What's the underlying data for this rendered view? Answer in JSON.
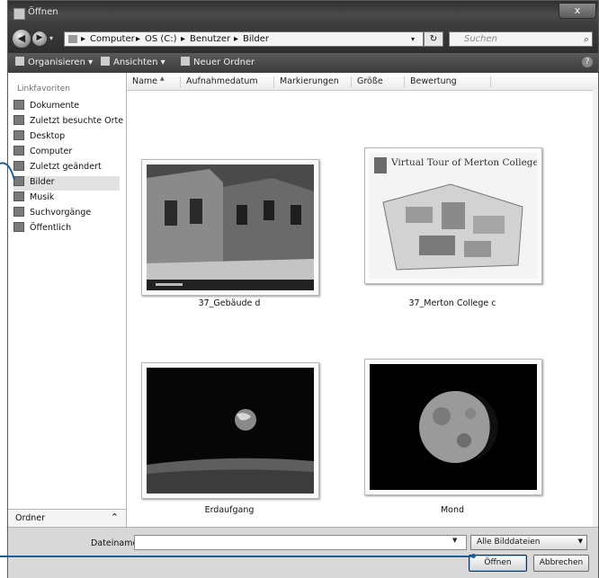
{
  "window": {
    "title": "Öffnen",
    "close_label": "x"
  },
  "address": {
    "crumbs": [
      "Computer",
      "OS (C:)",
      "Benutzer",
      "Bilder"
    ],
    "separator": "▸",
    "search_placeholder": "Suchen",
    "refresh_label": "↻",
    "dropdown_label": "▾"
  },
  "toolbar": {
    "organize": "Organisieren",
    "views": "Ansichten",
    "new_folder": "Neuer Ordner",
    "help": "?"
  },
  "nav": {
    "header": "Linkfavoriten",
    "items": [
      {
        "label": "Dokumente",
        "icon": "documents-icon"
      },
      {
        "label": "Zuletzt besuchte Orte",
        "icon": "recent-places-icon"
      },
      {
        "label": "Desktop",
        "icon": "desktop-icon"
      },
      {
        "label": "Computer",
        "icon": "computer-icon"
      },
      {
        "label": "Zuletzt geändert",
        "icon": "recently-changed-icon"
      },
      {
        "label": "Bilder",
        "icon": "pictures-icon"
      },
      {
        "label": "Musik",
        "icon": "music-icon"
      },
      {
        "label": "Suchvorgänge",
        "icon": "searches-icon"
      },
      {
        "label": "Öffentlich",
        "icon": "public-icon"
      }
    ],
    "selected": "Bilder",
    "folder_label": "Ordner",
    "folder_chevron": "⌃"
  },
  "columns": [
    "Name",
    "Aufnahmedatum",
    "Markierungen",
    "Größe",
    "Bewertung"
  ],
  "files": [
    {
      "name": "37_Gebäude d"
    },
    {
      "name": "37_Merton College c",
      "image_text": "Virtual Tour of Merton College"
    },
    {
      "name": "Erdaufgang"
    },
    {
      "name": "Mond"
    }
  ],
  "footer": {
    "filename_label": "Dateiname:",
    "filename_value": "",
    "filetype": "Alle Bilddateien",
    "open_button": "Öffnen",
    "cancel_button": "Abbrechen"
  },
  "colors": {
    "callout": "#1a5e9e",
    "titlebar": "#3a3a3a"
  }
}
